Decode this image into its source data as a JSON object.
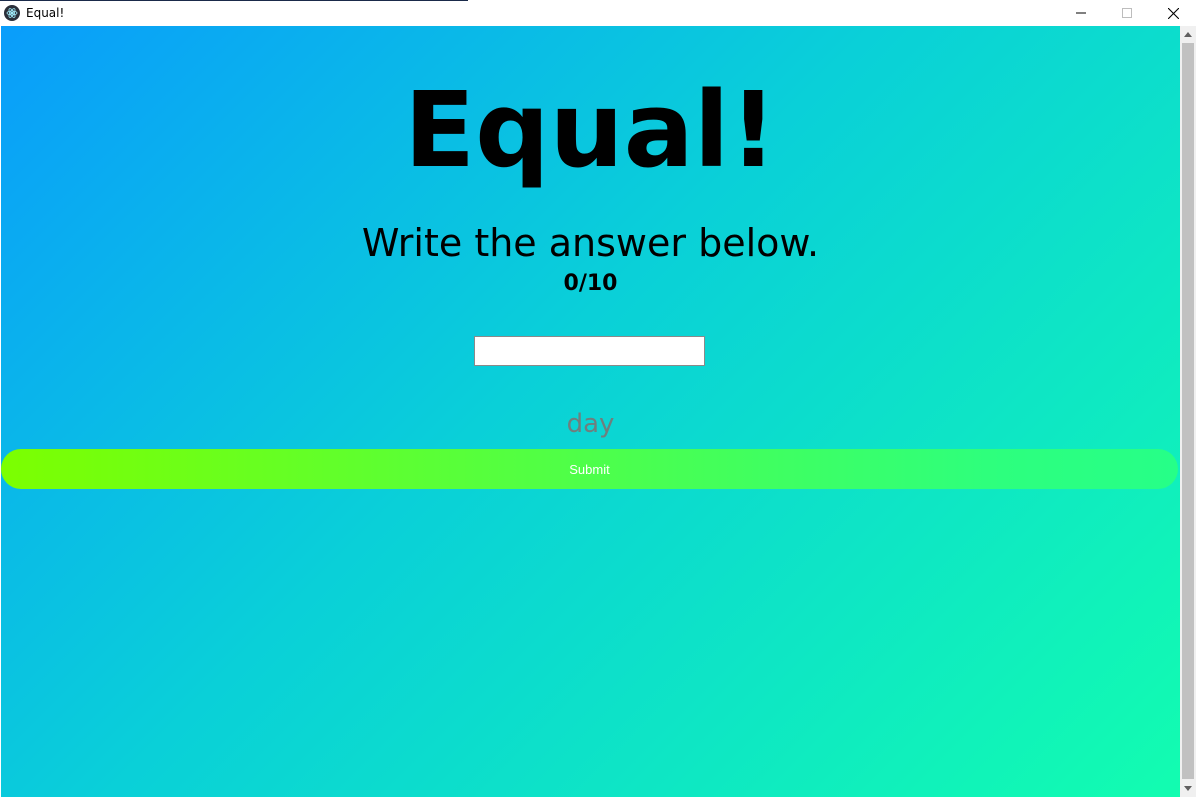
{
  "window": {
    "title": "Equal!",
    "app_icon": "electron-icon",
    "controls": {
      "minimize_icon": "minimize-icon",
      "maximize_icon": "maximize-icon",
      "close_icon": "close-icon"
    }
  },
  "game": {
    "title": "Equal!",
    "instruction": "Write the answer below.",
    "score": "0/10",
    "answer_value": "",
    "word": "day",
    "submit_label": "Submit"
  },
  "colors": {
    "background_gradient_start": "#0a9dfb",
    "background_gradient_end": "#12fdb0",
    "submit_gradient_start": "#7cff00",
    "submit_gradient_end": "#26ff88",
    "word_color": "#6f7f7e"
  }
}
